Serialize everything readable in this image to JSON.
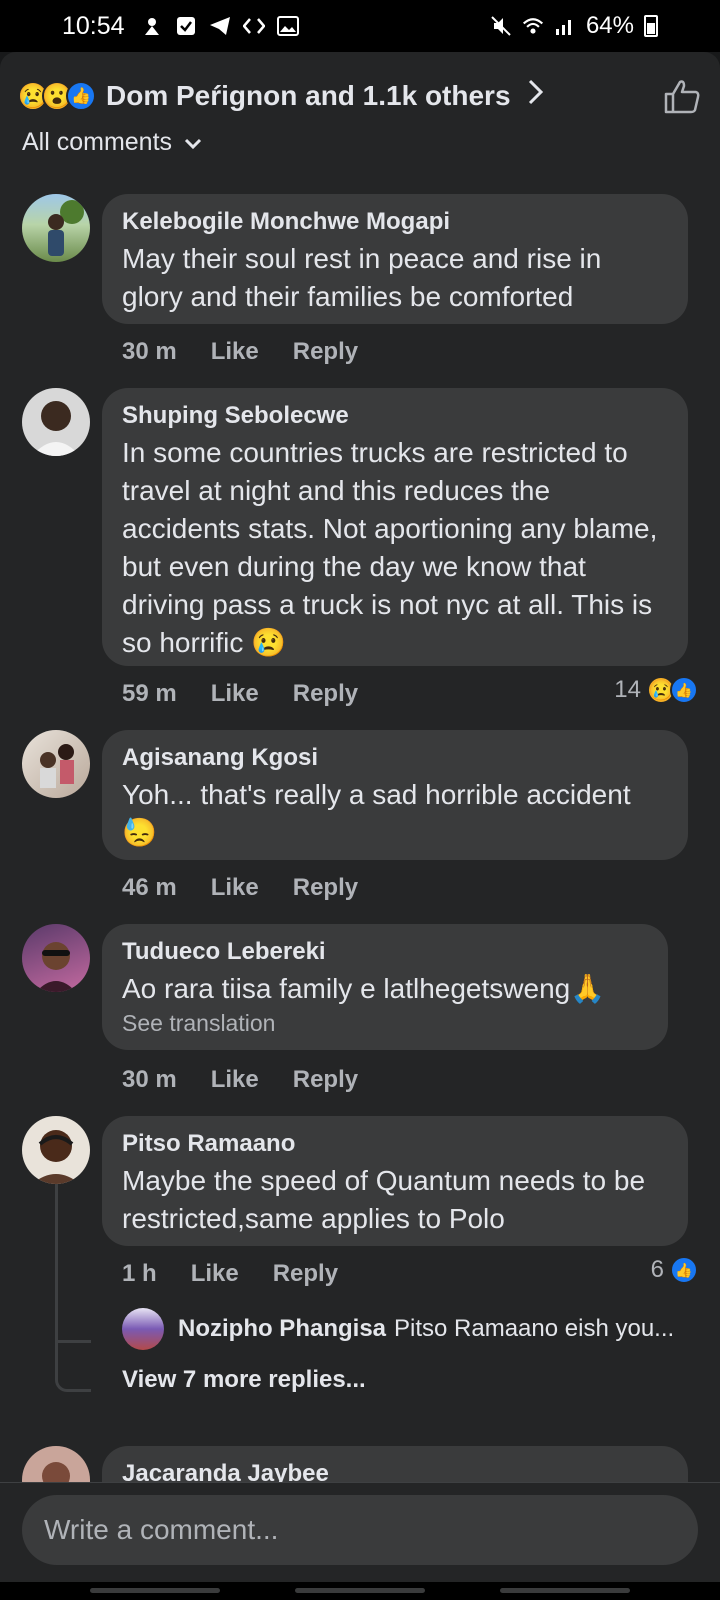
{
  "status_bar": {
    "time": "10:54",
    "battery": "64%",
    "left_icons": [
      "app-icon",
      "check-icon",
      "telegram-icon",
      "code-icon",
      "image-icon"
    ],
    "right_icons": [
      "mute-icon",
      "wifi-icon",
      "signal-icon",
      "battery-icon"
    ]
  },
  "reactions": {
    "emojis": [
      "sad",
      "wow",
      "like"
    ],
    "text": "Dom Peŕignon and 1.1k others"
  },
  "filter": {
    "label": "All comments"
  },
  "comments": [
    {
      "author": "Kelebogile Monchwe Mogapi",
      "text": "May their soul rest in peace and rise in glory and their families be comforted",
      "time": "30 m",
      "like": "Like",
      "reply": "Reply"
    },
    {
      "author": "Shuping Sebolecwe",
      "text": "In some countries trucks are restricted to travel at night and this reduces the accidents stats. Not aportioning any blame, but even during the day we know that driving pass a truck is not nyc at all. This is so horrific 😢",
      "time": "59 m",
      "like": "Like",
      "reply": "Reply",
      "reaction_count": "14"
    },
    {
      "author": "Agisanang Kgosi",
      "text": "Yoh... that's really a sad horrible accident 😓",
      "time": "46 m",
      "like": "Like",
      "reply": "Reply"
    },
    {
      "author": "Tudueco Lebereki",
      "text": "Ao rara tiisa family e latlhegetsweng🙏",
      "translate": "See translation",
      "time": "30 m",
      "like": "Like",
      "reply": "Reply"
    },
    {
      "author": "Pitso Ramaano",
      "text": "Maybe the speed of Quantum needs to be restricted,same applies to Polo",
      "time": "1 h",
      "like": "Like",
      "reply": "Reply",
      "reaction_count": "6",
      "reply_preview": {
        "author": "Nozipho Phangisa",
        "snippet": "Pitso Ramaano eish you..."
      },
      "more_replies": "View 7 more replies..."
    },
    {
      "author": "Jacaranda Jaybee"
    }
  ],
  "composer": {
    "placeholder": "Write a comment..."
  },
  "colors": {
    "background": "#18191a",
    "sheet": "#242526",
    "bubble": "#3a3b3c",
    "text": "#e4e6eb",
    "secondary_text": "#b0b3b8",
    "like_blue": "#1877f2",
    "sad_yellow": "#f7b125"
  }
}
